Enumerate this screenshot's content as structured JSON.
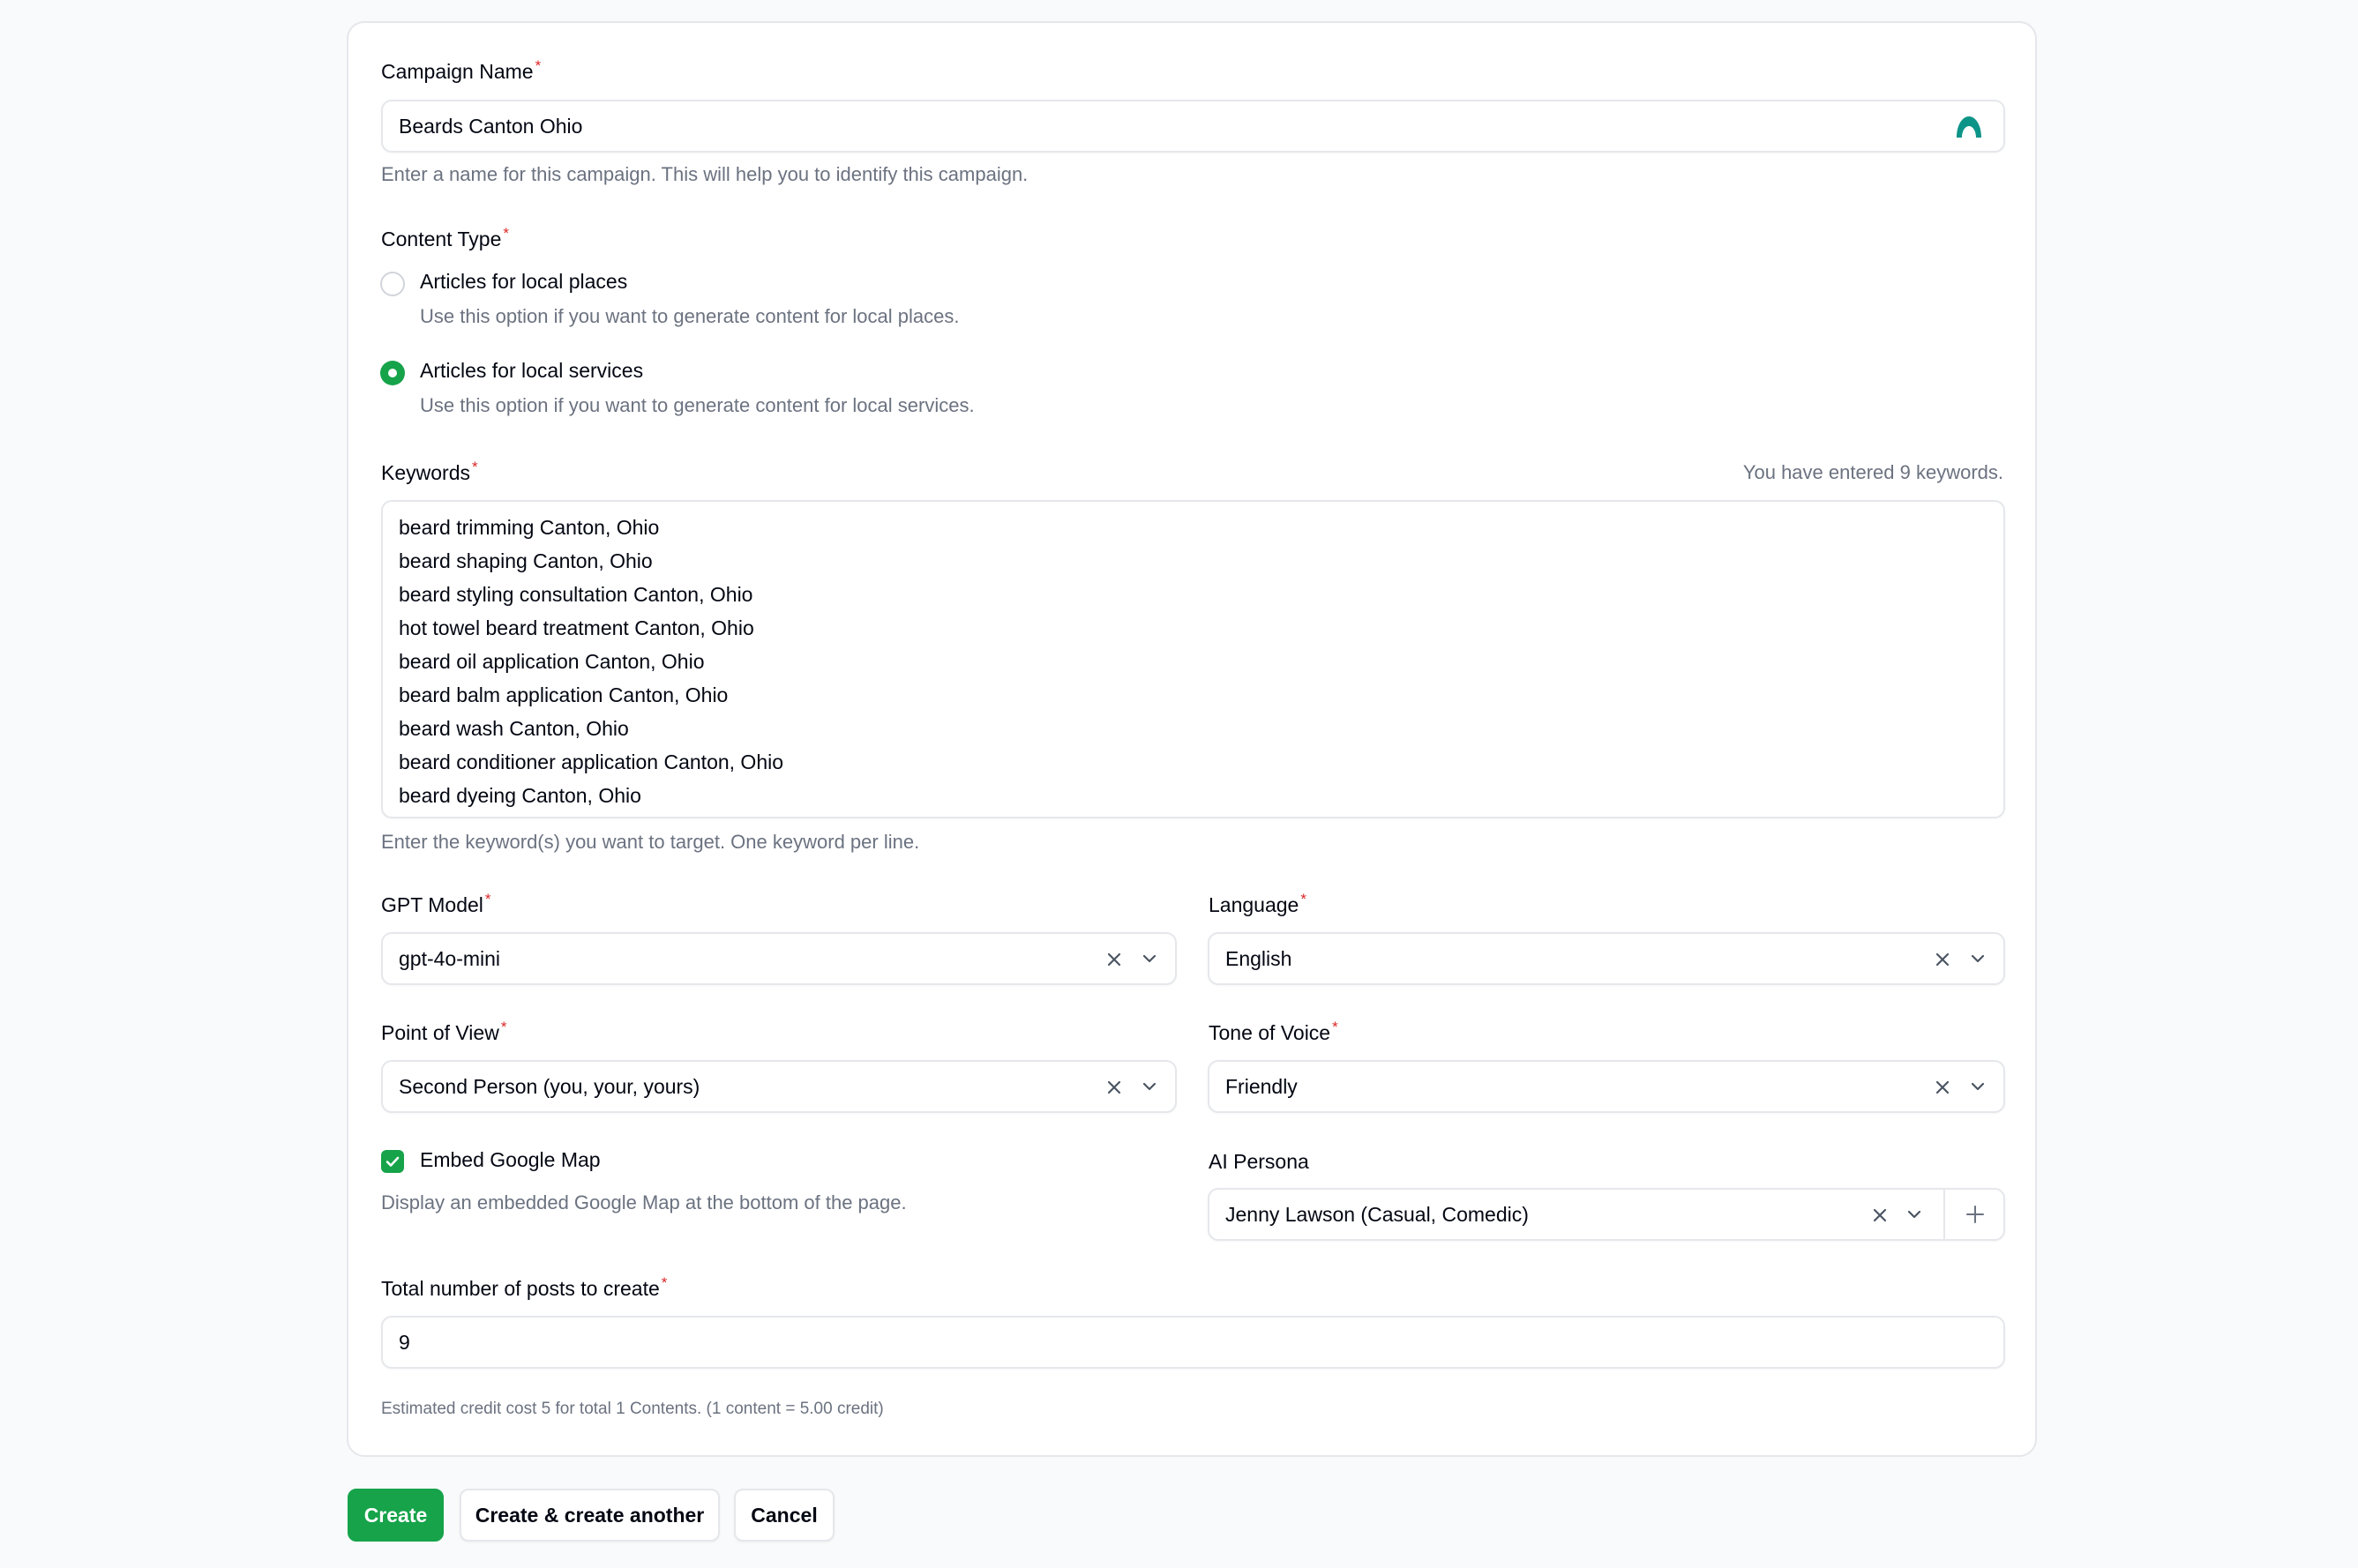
{
  "campaign_name": {
    "label": "Campaign Name",
    "required_mark": "*",
    "value": "Beards Canton Ohio",
    "helper": "Enter a name for this campaign. This will help you to identify this campaign."
  },
  "content_type": {
    "label": "Content Type",
    "required_mark": "*",
    "options": [
      {
        "label": "Articles for local places",
        "description": "Use this option if you want to generate content for local places.",
        "selected": false
      },
      {
        "label": "Articles for local services",
        "description": "Use this option if you want to generate content for local services.",
        "selected": true
      }
    ]
  },
  "keywords": {
    "label": "Keywords",
    "required_mark": "*",
    "count_text": "You have entered 9 keywords.",
    "lines": [
      "beard trimming Canton, Ohio",
      "beard shaping Canton, Ohio",
      "beard styling consultation Canton, Ohio",
      "hot towel beard treatment Canton, Ohio",
      "beard oil application Canton, Ohio",
      "beard balm application Canton, Ohio",
      "beard wash Canton, Ohio",
      "beard conditioner application Canton, Ohio",
      "beard dyeing Canton, Ohio"
    ],
    "helper": "Enter the keyword(s) you want to target. One keyword per line."
  },
  "gpt_model": {
    "label": "GPT Model",
    "required_mark": "*",
    "value": "gpt-4o-mini"
  },
  "language": {
    "label": "Language",
    "required_mark": "*",
    "value": "English"
  },
  "point_of_view": {
    "label": "Point of View",
    "required_mark": "*",
    "value": "Second Person (you, your, yours)"
  },
  "tone_of_voice": {
    "label": "Tone of Voice",
    "required_mark": "*",
    "value": "Friendly"
  },
  "embed_map": {
    "label": "Embed Google Map",
    "checked": true,
    "helper": "Display an embedded Google Map at the bottom of the page."
  },
  "ai_persona": {
    "label": "AI Persona",
    "value": "Jenny Lawson (Casual, Comedic)"
  },
  "total_posts": {
    "label": "Total number of posts to create",
    "required_mark": "*",
    "value": "9"
  },
  "credit_note": "Estimated credit cost 5 for total 1 Contents. (1 content = 5.00 credit)",
  "buttons": {
    "create": "Create",
    "create_another": "Create & create another",
    "cancel": "Cancel"
  },
  "colors": {
    "primary": "#16a34a",
    "required": "#dc2626",
    "muted_text": "#6b7280",
    "border": "#e5e7eb",
    "extension_icon": "#0d9488"
  },
  "icons": [
    "extension-logo-icon",
    "clear-x-icon",
    "chevron-down-icon",
    "plus-icon",
    "check-icon"
  ]
}
